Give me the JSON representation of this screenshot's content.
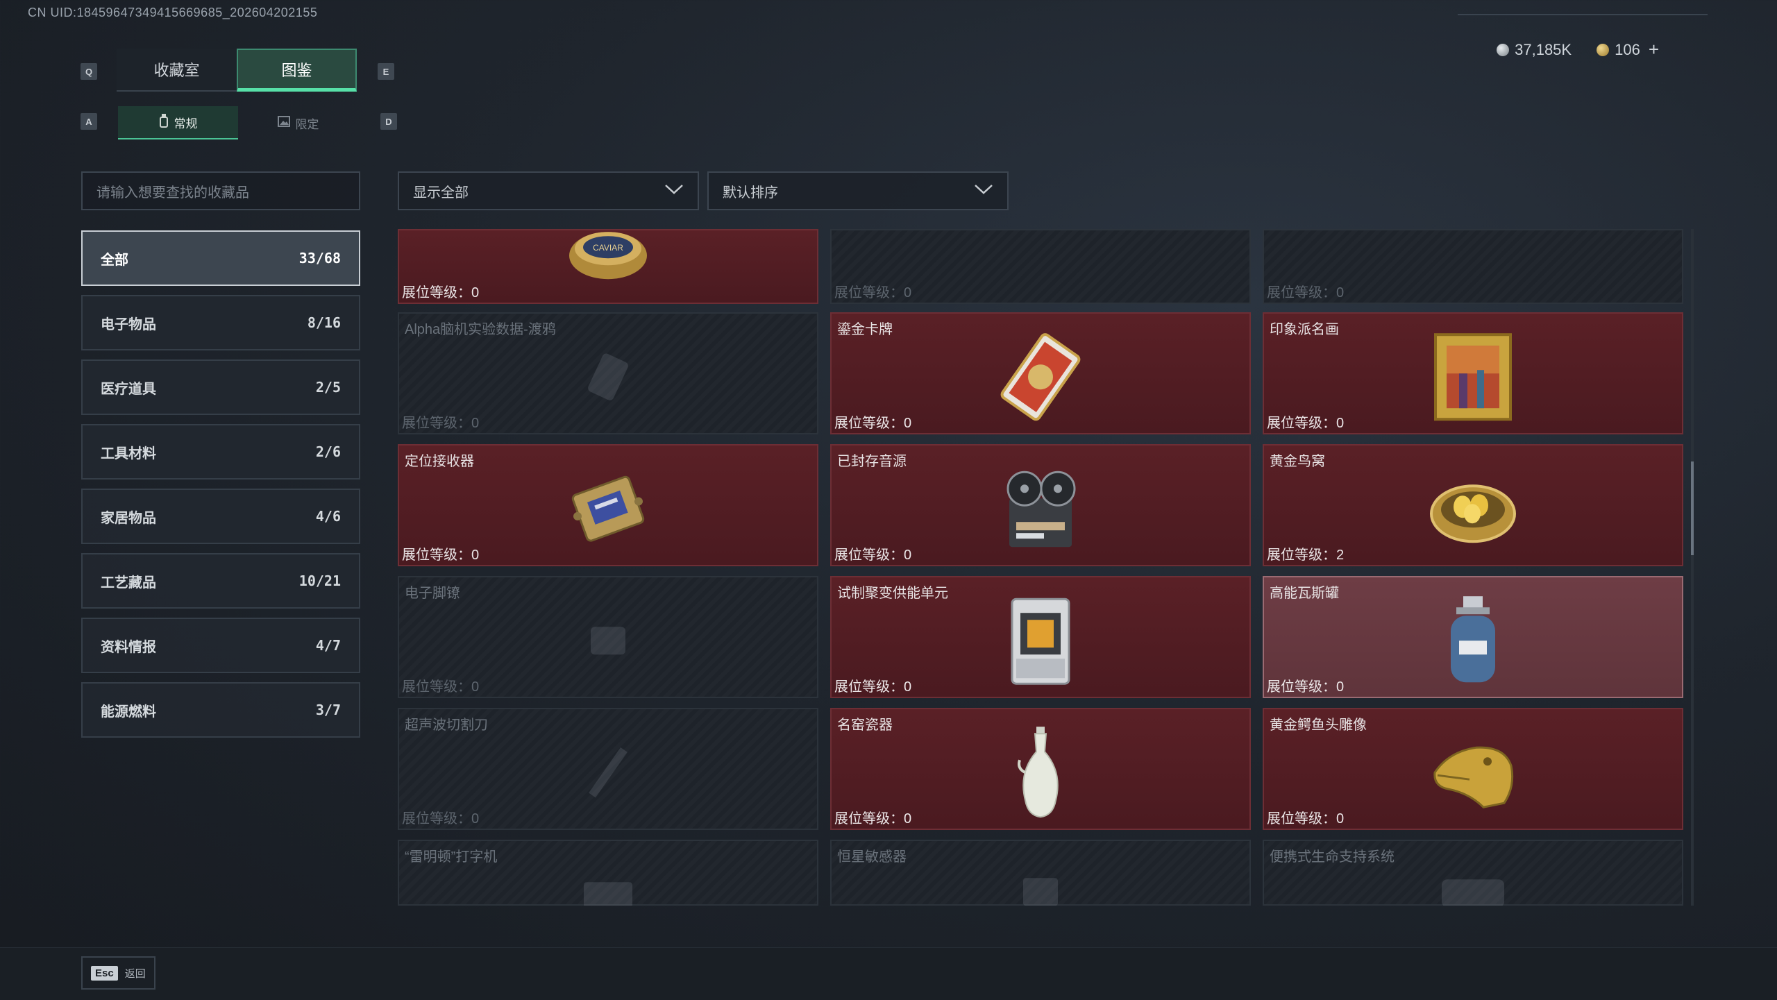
{
  "uid": "CN UID:18459647349415669685_202604202155",
  "currency": {
    "silver": "37,185K",
    "gold": "106",
    "plus": "+"
  },
  "keys": {
    "left_main": "Q",
    "right_main": "E",
    "left_sub": "A",
    "right_sub": "D"
  },
  "main_tabs": [
    {
      "label": "收藏室"
    },
    {
      "label": "图鉴"
    }
  ],
  "sub_tabs": [
    {
      "label": "常规"
    },
    {
      "label": "限定"
    }
  ],
  "search": {
    "placeholder": "请输入想要查找的收藏品"
  },
  "filters": {
    "show": "显示全部",
    "sort": "默认排序"
  },
  "categories": [
    {
      "label": "全部",
      "count": "33/68"
    },
    {
      "label": "电子物品",
      "count": "8/16"
    },
    {
      "label": "医疗道具",
      "count": "2/5"
    },
    {
      "label": "工具材料",
      "count": "2/6"
    },
    {
      "label": "家居物品",
      "count": "4/6"
    },
    {
      "label": "工艺藏品",
      "count": "10/21"
    },
    {
      "label": "资料情报",
      "count": "4/7"
    },
    {
      "label": "能源燃料",
      "count": "3/7"
    }
  ],
  "items": [
    {
      "name": "",
      "level": "展位等级：0",
      "icon": "caviar-tin-icon"
    },
    {
      "name": "",
      "level": "展位等级：0",
      "icon": "unknown-item-icon"
    },
    {
      "name": "",
      "level": "展位等级：0",
      "icon": "unknown-item-icon"
    },
    {
      "name": "Alpha脑机实验数据-渡鸦",
      "level": "展位等级：0",
      "icon": "data-drive-icon"
    },
    {
      "name": "鎏金卡牌",
      "level": "展位等级：0",
      "icon": "gilded-card-icon"
    },
    {
      "name": "印象派名画",
      "level": "展位等级：0",
      "icon": "framed-painting-icon"
    },
    {
      "name": "定位接收器",
      "level": "展位等级：0",
      "icon": "receiver-icon"
    },
    {
      "name": "已封存音源",
      "level": "展位等级：0",
      "icon": "reel-recorder-icon"
    },
    {
      "name": "黄金鸟窝",
      "level": "展位等级：2",
      "icon": "golden-nest-icon"
    },
    {
      "name": "电子脚镣",
      "level": "展位等级：0",
      "icon": "ankle-monitor-icon"
    },
    {
      "name": "试制聚变供能单元",
      "level": "展位等级：0",
      "icon": "fusion-cell-icon"
    },
    {
      "name": "高能瓦斯罐",
      "level": "展位等级：0",
      "icon": "gas-canister-icon"
    },
    {
      "name": "超声波切割刀",
      "level": "展位等级：0",
      "icon": "ultrasonic-cutter-icon"
    },
    {
      "name": "名窑瓷器",
      "level": "展位等级：0",
      "icon": "porcelain-vase-icon"
    },
    {
      "name": "黄金鳄鱼头雕像",
      "level": "展位等级：0",
      "icon": "gold-crocodile-icon"
    },
    {
      "name": "“雷明顿”打字机",
      "level": "",
      "icon": "typewriter-icon"
    },
    {
      "name": "恒星敏感器",
      "level": "",
      "icon": "star-sensor-icon"
    },
    {
      "name": "便携式生命支持系统",
      "level": "",
      "icon": "life-support-icon"
    }
  ],
  "footer": {
    "esc_key": "Esc",
    "back_label": "返回"
  }
}
